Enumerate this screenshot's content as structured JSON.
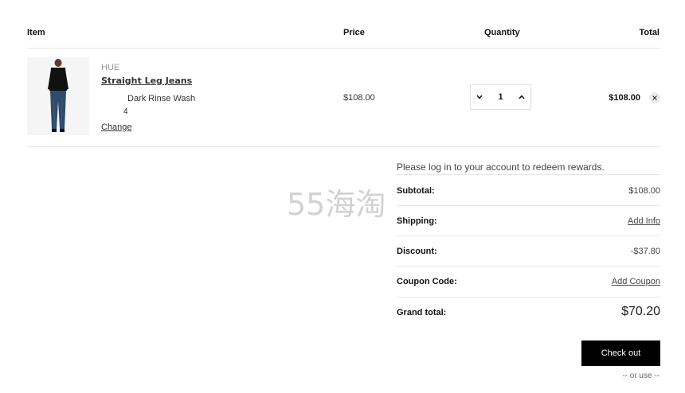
{
  "headers": {
    "item": "Item",
    "price": "Price",
    "quantity": "Quantity",
    "total": "Total"
  },
  "cart_item": {
    "brand": "HUE",
    "name": "Straight Leg Jeans",
    "color": "Dark Rinse Wash",
    "size": "4",
    "change_label": "Change",
    "price": "$108.00",
    "quantity": "1",
    "line_total": "$108.00"
  },
  "summary": {
    "rewards_message": "Please log in to your account to redeem rewards.",
    "rows": [
      {
        "label": "Subtotal:",
        "value": "$108.00"
      },
      {
        "label": "Shipping:",
        "value": "Add Info"
      },
      {
        "label": "Discount:",
        "value": "-$37.80"
      },
      {
        "label": "Coupon Code:",
        "value": "Add Coupon"
      },
      {
        "label": "Grand total:",
        "value": "$70.20"
      }
    ]
  },
  "checkout_label": "Check out",
  "or_use_label": "-- or use --",
  "watermark": "55海淘",
  "icons": {
    "decrease": "chevron-down-icon",
    "increase": "chevron-up-icon",
    "remove": "close-icon"
  },
  "colors": {
    "checkout_bg": "#000000",
    "divider": "#e6e6e6"
  }
}
